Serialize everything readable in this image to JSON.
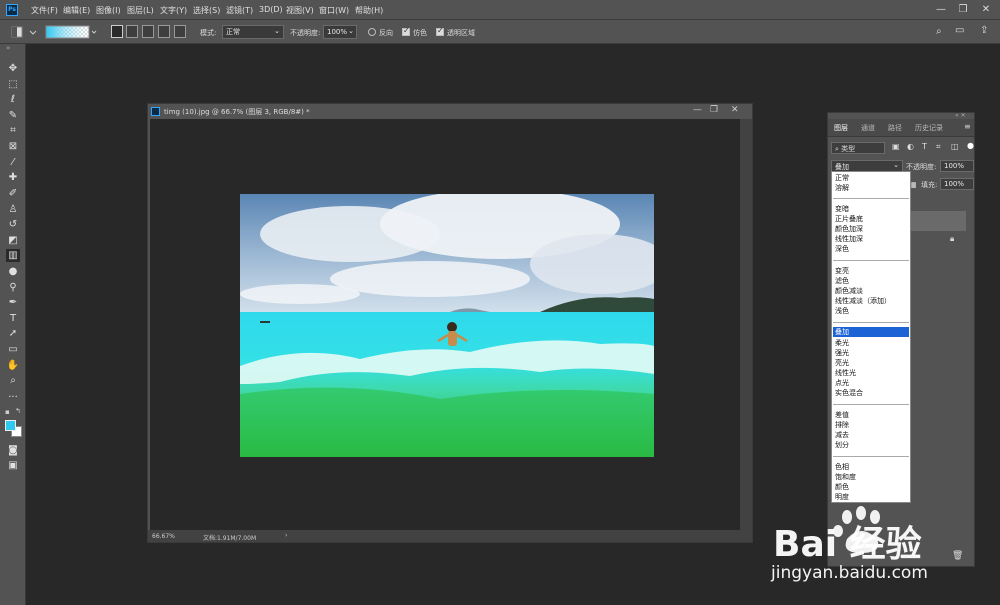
{
  "app": {
    "logo": "Ps",
    "accent": "#31a8ff"
  },
  "menubar": {
    "items": [
      "文件(F)",
      "编辑(E)",
      "图像(I)",
      "图层(L)",
      "文字(Y)",
      "选择(S)",
      "滤镜(T)",
      "3D(D)",
      "视图(V)",
      "窗口(W)",
      "帮助(H)"
    ],
    "window_controls": [
      "minimize-icon",
      "maximize-icon",
      "close-icon"
    ]
  },
  "options": {
    "mode_label": "模式:",
    "mode_value": "正常",
    "opacity_label": "不透明度:",
    "opacity_value": "100%",
    "reverse_label": "反向",
    "dither_label": "仿色",
    "transparency_label": "透明区域",
    "gradient_colors": [
      "#2ec8f0",
      "#ffffff"
    ]
  },
  "document": {
    "title": "timg (10).jpg @ 66.7% (图层 3, RGB/8#) *",
    "zoom": "66.67%",
    "doc_size": "文档:1.91M/7.00M"
  },
  "layers_panel": {
    "tabs": [
      "图层",
      "通道",
      "路径",
      "历史记录"
    ],
    "filter_kind": "类型",
    "blend_mode": "叠加",
    "opacity_label": "不透明度:",
    "opacity_value": "100%",
    "fill_label": "填充:",
    "fill_value": "100%"
  },
  "blend_dropdown": {
    "groups": [
      [
        "正常",
        "溶解"
      ],
      [
        "变暗",
        "正片叠底",
        "颜色加深",
        "线性加深",
        "深色"
      ],
      [
        "变亮",
        "滤色",
        "颜色减淡",
        "线性减淡（添加）",
        "浅色"
      ],
      [
        "叠加",
        "柔光",
        "强光",
        "亮光",
        "线性光",
        "点光",
        "实色混合"
      ],
      [
        "差值",
        "排除",
        "减去",
        "划分"
      ],
      [
        "色相",
        "饱和度",
        "颜色",
        "明度"
      ]
    ],
    "selected": "叠加",
    "selected_color": "#1c63d6"
  },
  "watermark": {
    "brand": "Bai  经验",
    "url": "jingyan.baidu.com"
  }
}
